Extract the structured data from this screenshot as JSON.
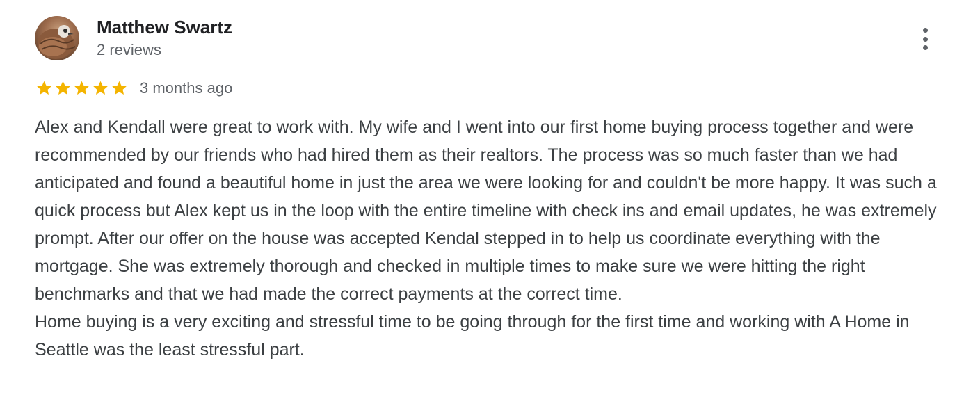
{
  "review": {
    "reviewer_name": "Matthew Swartz",
    "review_count": "2 reviews",
    "rating": 5,
    "rating_max": 5,
    "date": "3 months ago",
    "text_paragraph_1": "Alex and Kendall were great to work with. My wife and I went into our first home buying process together and were recommended by our friends who had hired them as their realtors. The process was so much faster than we had anticipated and found a beautiful home in just the area we were looking for and couldn't be more happy. It was such a quick process but Alex kept us in the loop with the entire timeline with check ins and email updates, he was extremely prompt. After our offer on the house was accepted Kendal stepped in to help us coordinate everything with the mortgage. She was extremely thorough and checked in multiple times to make sure we were hitting the right benchmarks and that we had made the correct payments at the correct time.",
    "text_paragraph_2": "Home buying is a very exciting and stressful time to be going through for the first time and working with A Home in Seattle was the least stressful part."
  },
  "icons": {
    "avatar": "avatar-photo",
    "menu": "more-vertical-icon",
    "star": "star-icon"
  },
  "colors": {
    "star_fill": "#f4b400",
    "name_text": "#202124",
    "secondary_text": "#5f6368",
    "body_text": "#3c4043"
  }
}
